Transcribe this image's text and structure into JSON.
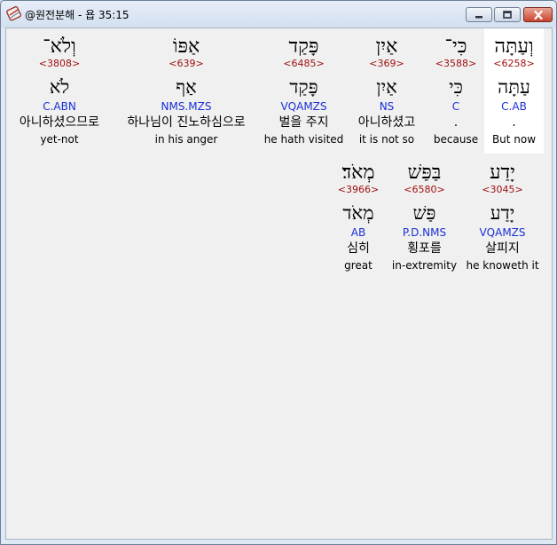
{
  "window": {
    "title": "@원전분해 - 욥 35:15",
    "app_icon": "app-scroll-icon",
    "controls": {
      "minimize": "minimize-icon",
      "maximize": "maximize-icon",
      "close": "close-icon",
      "close_color": "#c9442f"
    }
  },
  "words": [
    {
      "hebrew": "וְעַתָּה",
      "strong": "<6258>",
      "lemma": "עַתָּה",
      "morph": "C.AB",
      "korean": ".",
      "english": "But now",
      "selected": true
    },
    {
      "hebrew": "כִּי־",
      "strong": "<3588>",
      "lemma": "כִּי",
      "morph": "C",
      "korean": ".",
      "english": "because",
      "selected": false
    },
    {
      "hebrew": "אַיִן",
      "strong": "<369>",
      "lemma": "אַיִן",
      "morph": "NS",
      "korean": "아니하셨고",
      "english": "it is not so",
      "selected": false
    },
    {
      "hebrew": "פָּקַד",
      "strong": "<6485>",
      "lemma": "פָּקַד",
      "morph": "VQAMZS",
      "korean": "벌을 주지",
      "english": "he hath visited",
      "selected": false
    },
    {
      "hebrew": "אַפּוֹ",
      "strong": "<639>",
      "lemma": "אַף",
      "morph": "NMS.MZS",
      "korean": "하나님이 진노하심으로",
      "english": "in his anger",
      "selected": false
    },
    {
      "hebrew": "וְלֹא־",
      "strong": "<3808>",
      "lemma": "לֹא",
      "morph": "C.ABN",
      "korean": "아니하셨으므로",
      "english": "yet-not",
      "selected": false
    },
    {
      "hebrew": "יָדַע",
      "strong": "<3045>",
      "lemma": "יָדַע",
      "morph": "VQAMZS",
      "korean": "살피지",
      "english": "he knoweth it",
      "selected": false
    },
    {
      "hebrew": "בַּפַּשׁ",
      "strong": "<6580>",
      "lemma": "פַּשׁ",
      "morph": "P.D.NMS",
      "korean": "횡포를",
      "english": "in-extremity",
      "selected": false
    },
    {
      "hebrew": "מְאֹד׃",
      "strong": "<3966>",
      "lemma": "מְאֹד",
      "morph": "AB",
      "korean": "심히",
      "english": "great",
      "selected": false
    }
  ],
  "colors": {
    "strong_number": "#a01010",
    "morphology": "#1a2fd6",
    "selected_background": "#ffffff"
  }
}
